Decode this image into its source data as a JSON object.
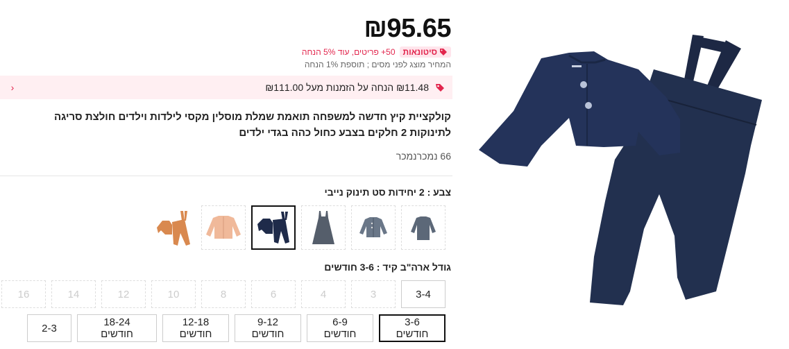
{
  "price": "₪95.65",
  "wholesale": {
    "badge_label": "סיטונאות",
    "text": "50+ פריטים, עוד 5% הנחה"
  },
  "tax_note": "המחיר מוצג לפני מסים ; תוספת 1% הנחה",
  "discount_banner": {
    "text": "₪11.48 הנחה על הזמנות מעל ₪111.00",
    "chevron": "‹"
  },
  "product": {
    "title": "קולקציית קיץ חדשה למשפחה תואמת שמלת מוסלין מקסי לילדות וילדים חולצת סריגה לתינוקות 2 חלקים בצבע כחול כהה בגדי ילדים",
    "sold": "66 נמכרנמכר"
  },
  "color": {
    "label": "צבע : 2 יחידות סט תינוק נייבי",
    "swatches": [
      {
        "name": "grey-long-sleeve-shirt",
        "color": "#5c6878"
      },
      {
        "name": "grey-cardigan",
        "color": "#6a7788"
      },
      {
        "name": "grey-dress",
        "color": "#555e6b"
      },
      {
        "name": "navy-baby-set",
        "color": "#1f2b4a"
      },
      {
        "name": "peach-cardigan",
        "color": "#f0b99a"
      },
      {
        "name": "orange-baby-set",
        "color": "#d9894f"
      }
    ]
  },
  "size": {
    "label": "גודל ארה\"ב קיד : 3-6 חודשים",
    "row1": [
      "3-4",
      "3",
      "4",
      "6",
      "8",
      "10",
      "12",
      "14",
      "16"
    ],
    "row2": [
      "3-6 חודשים",
      "6-9 חודשים",
      "9-12 חודשים",
      "12-18 חודשים",
      "18-24 חודשים",
      "2-3"
    ]
  },
  "colors": {
    "accent": "#e2264d",
    "navy": "#1f2b4a",
    "banner_bg": "#ffeff2"
  }
}
